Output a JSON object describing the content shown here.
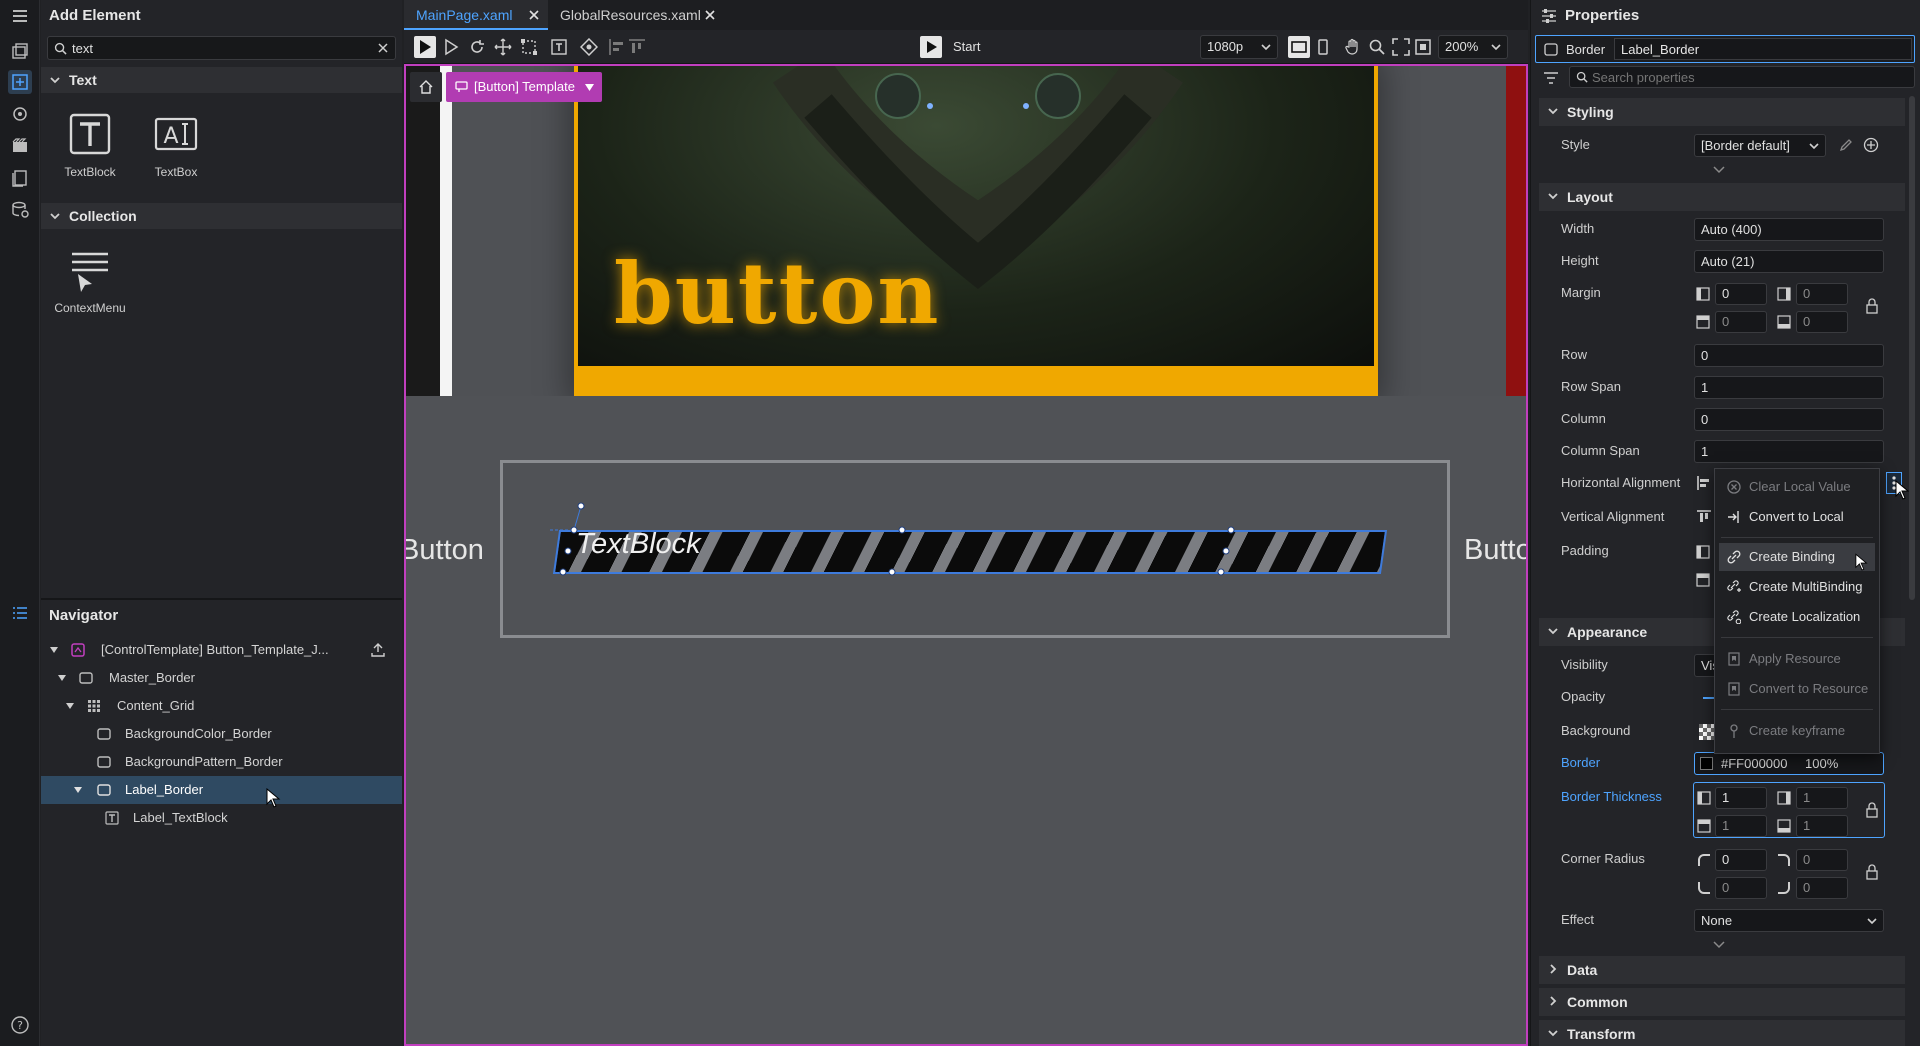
{
  "add_element": {
    "title": "Add Element",
    "search_value": "text",
    "sections": [
      {
        "name": "Text",
        "items": [
          "TextBlock",
          "TextBox"
        ]
      },
      {
        "name": "Collection",
        "items": [
          "ContextMenu"
        ]
      }
    ]
  },
  "navigator": {
    "title": "Navigator",
    "nodes": [
      {
        "label": "[ControlTemplate] Button_Template_J..."
      },
      {
        "label": "Master_Border"
      },
      {
        "label": "Content_Grid"
      },
      {
        "label": "BackgroundColor_Border"
      },
      {
        "label": "BackgroundPattern_Border"
      },
      {
        "label": "Label_Border"
      },
      {
        "label": "Label_TextBlock"
      }
    ]
  },
  "tabs": [
    {
      "label": "MainPage.xaml"
    },
    {
      "label": "GlobalResources.xaml"
    }
  ],
  "toolbar": {
    "start_label": "Start",
    "resolution": "1080p",
    "zoom": "200%"
  },
  "canvas": {
    "breadcrumb_label": "[Button] Template",
    "hero_text": "button",
    "left_button_text": "Button",
    "right_button_text": "Butto",
    "textblock_text": "TextBlock"
  },
  "properties": {
    "title": "Properties",
    "element_type": "Border",
    "element_name": "Label_Border",
    "search_placeholder": "Search properties",
    "sections": {
      "styling": "Styling",
      "layout": "Layout",
      "appearance": "Appearance",
      "data": "Data",
      "common": "Common",
      "transform": "Transform"
    },
    "style": {
      "label": "Style",
      "value": "[Border default]"
    },
    "layout": {
      "width": {
        "label": "Width",
        "value": "Auto (400)"
      },
      "height": {
        "label": "Height",
        "value": "Auto (21)"
      },
      "margin": {
        "label": "Margin",
        "values": [
          "0",
          "0",
          "0",
          "0"
        ]
      },
      "row": {
        "label": "Row",
        "value": "0"
      },
      "row_span": {
        "label": "Row Span",
        "value": "1"
      },
      "column": {
        "label": "Column",
        "value": "0"
      },
      "column_span": {
        "label": "Column Span",
        "value": "1"
      },
      "horizontal_alignment": {
        "label": "Horizontal Alignment"
      },
      "vertical_alignment": {
        "label": "Vertical Alignment"
      },
      "padding": {
        "label": "Padding"
      }
    },
    "appearance": {
      "visibility": {
        "label": "Visibility",
        "value": "Vis"
      },
      "opacity": {
        "label": "Opacity"
      },
      "background": {
        "label": "Background"
      },
      "border": {
        "label": "Border",
        "color": "#FF000000",
        "alpha": "100%"
      },
      "border_thickness": {
        "label": "Border Thickness",
        "values": [
          "1",
          "1",
          "1",
          "1"
        ]
      },
      "corner_radius": {
        "label": "Corner Radius",
        "values": [
          "0",
          "0",
          "0",
          "0"
        ]
      },
      "effect": {
        "label": "Effect",
        "value": "None"
      }
    }
  },
  "context_menu": {
    "items": [
      {
        "label": "Clear Local Value",
        "enabled": false
      },
      {
        "label": "Convert to Local",
        "enabled": true
      },
      {
        "label": "Create Binding",
        "enabled": true,
        "highlighted": true
      },
      {
        "label": "Create MultiBinding",
        "enabled": true
      },
      {
        "label": "Create Localization",
        "enabled": true
      },
      {
        "label": "Apply Resource",
        "enabled": false
      },
      {
        "label": "Convert to Resource",
        "enabled": false
      },
      {
        "label": "Create keyframe",
        "enabled": false
      }
    ]
  },
  "colors": {
    "accent": "#4ea4ff",
    "template_magenta": "#c13fbf",
    "hero_gold": "#f0a800",
    "selection_row": "#2f4a62"
  }
}
